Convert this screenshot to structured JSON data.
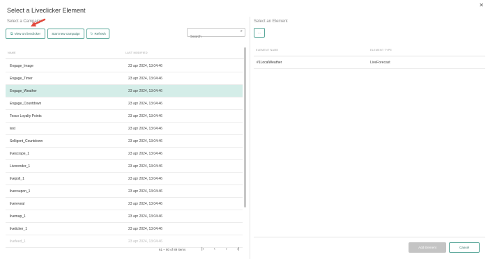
{
  "dialog": {
    "title": "Select a Liveclicker Element",
    "close_label": "✕"
  },
  "campaign_panel": {
    "section_label": "Select a Campaign",
    "buttons": {
      "view": "View on liveclicker",
      "start": "Start new campaign",
      "refresh": "Refresh"
    },
    "search_placeholder": "Search",
    "columns": {
      "name": "NAME",
      "last_modified": "LAST MODIFIED"
    },
    "rows": [
      {
        "name": "Engage_Image",
        "date": "23 apr 2024, 13:04:46"
      },
      {
        "name": "Engage_Timer",
        "date": "23 apr 2024, 13:04:46"
      },
      {
        "name": "Engage_Weather",
        "date": "23 apr 2024, 13:04:46"
      },
      {
        "name": "Engage_Countdown",
        "date": "23 apr 2024, 13:04:46"
      },
      {
        "name": "Tesco Loyalty Points",
        "date": "23 apr 2024, 13:04:46"
      },
      {
        "name": "test",
        "date": "23 apr 2024, 13:04:46"
      },
      {
        "name": "Selligent_Countdown",
        "date": "23 apr 2024, 13:04:46"
      },
      {
        "name": "livescrape_1",
        "date": "23 apr 2024, 13:04:46"
      },
      {
        "name": "Liverender_1",
        "date": "23 apr 2024, 13:04:46"
      },
      {
        "name": "livepoll_1",
        "date": "23 apr 2024, 13:04:46"
      },
      {
        "name": "livecoupon_1",
        "date": "23 apr 2024, 13:04:46"
      },
      {
        "name": "livereveal",
        "date": "23 apr 2024, 13:04:46"
      },
      {
        "name": "livemap_1",
        "date": "23 apr 2024, 13:04:46"
      },
      {
        "name": "liveticker_1",
        "date": "23 apr 2024, 13:04:46"
      },
      {
        "name": "livefeed_1",
        "date": "23 apr 2024, 13:04:46"
      }
    ],
    "selected_row": "Engage_Weather",
    "pagination": {
      "range_text": "61 – 80 of 89 items",
      "first": "|‹",
      "prev": "‹",
      "next": "›",
      "last": "›|"
    }
  },
  "element_panel": {
    "section_label": "Select an Element",
    "ellipsis_label": "···",
    "columns": {
      "name": "ELEMENT NAME",
      "type": "ELEMENT TYPE"
    },
    "rows": [
      {
        "name": "#1LocalWeather",
        "type": "LiveForecast"
      }
    ],
    "footer": {
      "add": "Add Element",
      "cancel": "Cancel"
    }
  },
  "colors": {
    "accent": "#5aa79a",
    "selected_row": "#d4ede8",
    "annotation_arrow": "#e2483b"
  }
}
